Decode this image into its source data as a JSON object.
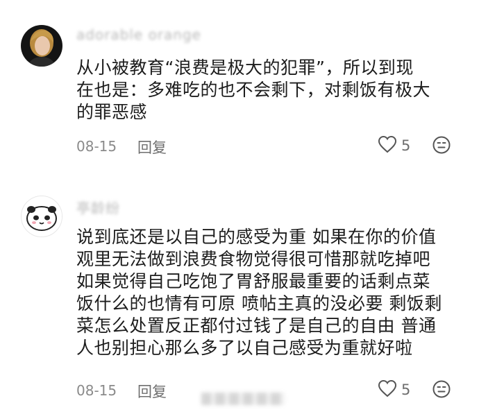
{
  "comments": [
    {
      "username": "adorable orange",
      "text_lines": [
        "从小被教育“浪费是极大的犯罪”，所以到现",
        "在也是：多难吃的也不会剩下，对剩饭有极大",
        "的罪恶感"
      ],
      "date": "08-15",
      "reply_label": "回复",
      "likes": "5"
    },
    {
      "username": "亭龄纷",
      "text_lines": [
        "说到底还是以自己的感受为重 如果在你的价值",
        "观里无法做到浪费食物觉得很可惜那就吃掉吧",
        "如果觉得自己吃饱了胃舒服最重要的话剩点菜",
        "饭什么的也情有可原 喷帖主真的没必要 剩饭剩",
        "菜怎么处置反正都付过钱了是自己的自由 普通",
        "人也别担心那么多了以自己感受为重就好啦"
      ],
      "date": "08-15",
      "reply_label": "回复",
      "likes": "5"
    }
  ]
}
